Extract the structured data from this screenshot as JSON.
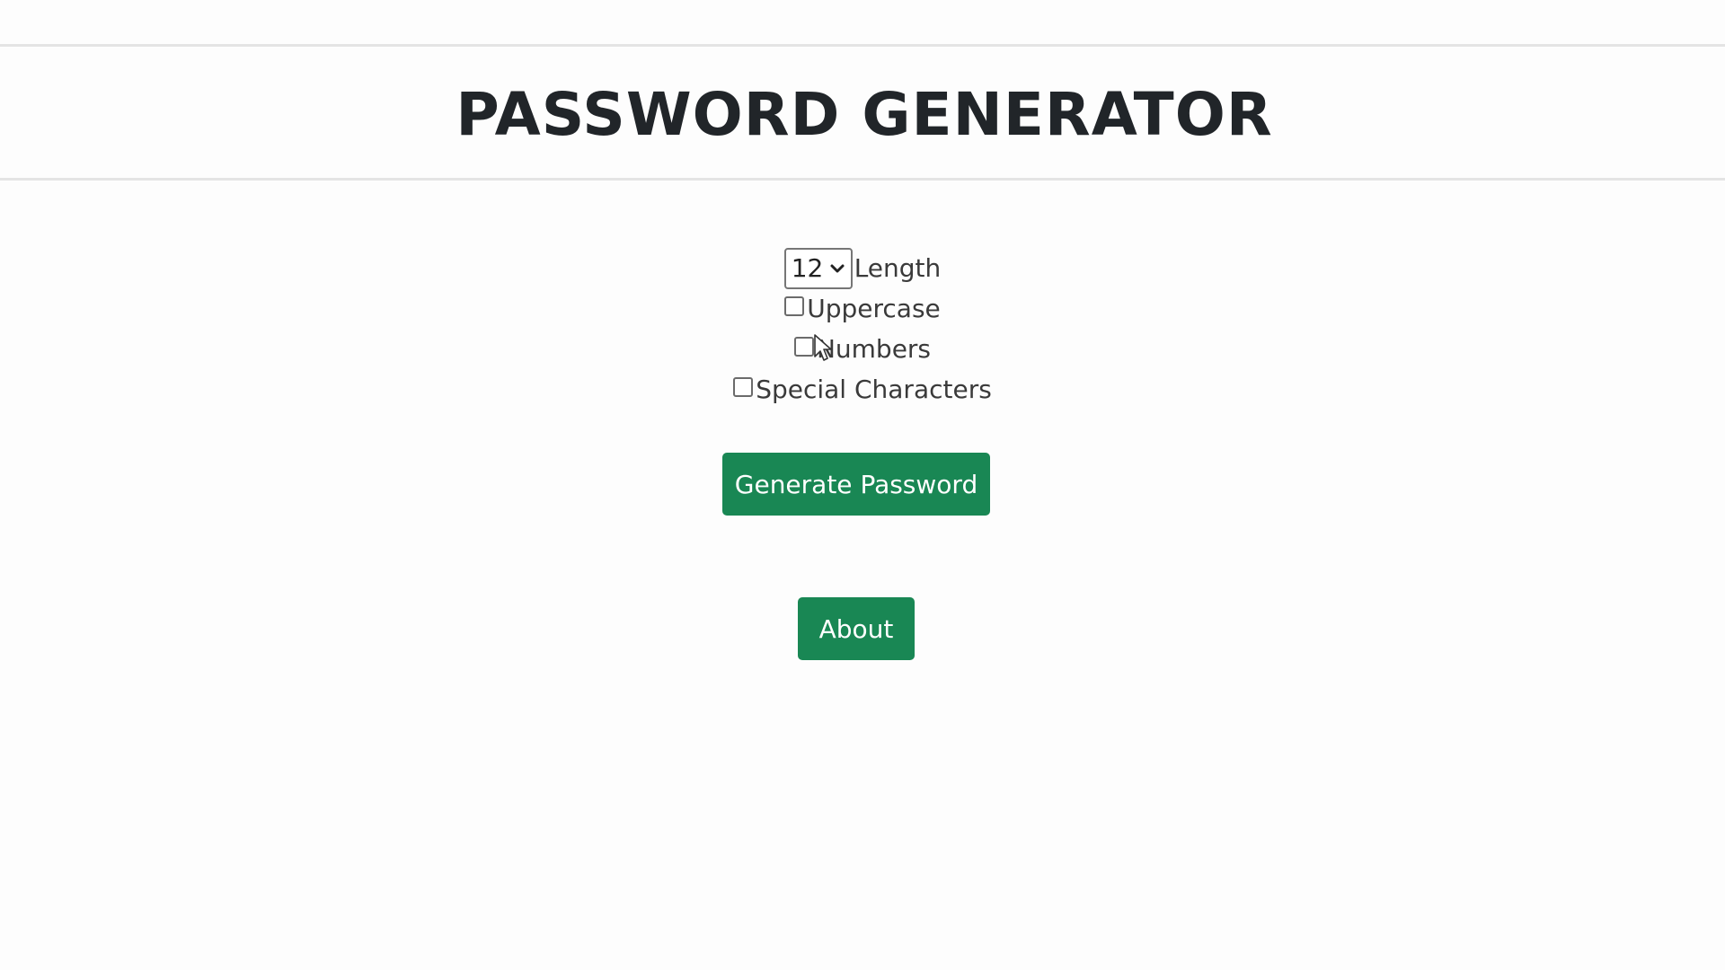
{
  "header": {
    "title": "PASSWORD GENERATOR"
  },
  "options": {
    "length": {
      "selected_value": "12",
      "label": "Length"
    },
    "uppercase": {
      "label": "Uppercase",
      "checked": false
    },
    "numbers": {
      "label": "Numbers",
      "checked": false
    },
    "special": {
      "label": "Special Characters",
      "checked": false
    }
  },
  "buttons": {
    "generate_label": "Generate Password",
    "about_label": "About"
  },
  "colors": {
    "button_green": "#198754",
    "background": "#fdfdfd",
    "divider": "#e4e4e4"
  },
  "icons": {
    "select_arrow": "chevron-down-icon",
    "pointer": "mouse-cursor-icon"
  }
}
